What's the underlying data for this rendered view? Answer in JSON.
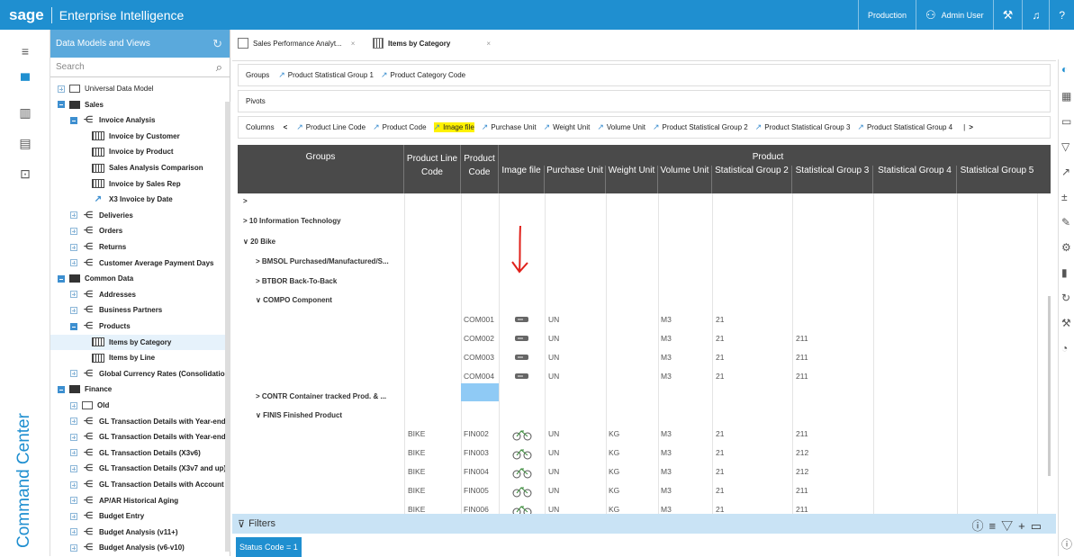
{
  "header": {
    "brand": "sage",
    "title": "Enterprise Intelligence",
    "env": "Production",
    "user": "Admin User"
  },
  "rail": {
    "vertical_label": "Command Center"
  },
  "panel": {
    "title": "Data Models and Views",
    "search_placeholder": "Search",
    "tree": [
      {
        "label": "Universal Data Model",
        "kind": "folder-empty",
        "indent": 0
      },
      {
        "label": "Sales",
        "kind": "folder",
        "indent": 0
      },
      {
        "label": "Invoice Analysis",
        "kind": "model",
        "indent": 1
      },
      {
        "label": "Invoice by Customer",
        "kind": "grid",
        "indent": 2
      },
      {
        "label": "Invoice by Product",
        "kind": "grid",
        "indent": 2
      },
      {
        "label": "Sales Analysis Comparison",
        "kind": "grid",
        "indent": 2
      },
      {
        "label": "Invoice by Sales Rep",
        "kind": "grid",
        "indent": 2
      },
      {
        "label": "X3 Invoice by Date",
        "kind": "chart",
        "indent": 2
      },
      {
        "label": "Deliveries",
        "kind": "model",
        "indent": 1
      },
      {
        "label": "Orders",
        "kind": "model",
        "indent": 1
      },
      {
        "label": "Returns",
        "kind": "model",
        "indent": 1
      },
      {
        "label": "Customer Average Payment Days",
        "kind": "model",
        "indent": 1
      },
      {
        "label": "Common Data",
        "kind": "folder",
        "indent": 0
      },
      {
        "label": "Addresses",
        "kind": "model",
        "indent": 1
      },
      {
        "label": "Business Partners",
        "kind": "model",
        "indent": 1
      },
      {
        "label": "Products",
        "kind": "model",
        "indent": 1
      },
      {
        "label": "Items by Category",
        "kind": "grid",
        "indent": 2
      },
      {
        "label": "Items by Line",
        "kind": "grid",
        "indent": 2
      },
      {
        "label": "Global Currency Rates (Consolidation)",
        "kind": "model",
        "indent": 1
      },
      {
        "label": "Finance",
        "kind": "folder",
        "indent": 0
      },
      {
        "label": "Old",
        "kind": "folder-empty",
        "indent": 1
      },
      {
        "label": "GL Transaction Details with Year-end S",
        "kind": "model",
        "indent": 1
      },
      {
        "label": "GL Transaction Details with Year-end S",
        "kind": "model",
        "indent": 1
      },
      {
        "label": "GL Transaction Details (X3v6)",
        "kind": "model",
        "indent": 1
      },
      {
        "label": "GL Transaction Details (X3v7 and up)",
        "kind": "model",
        "indent": 1
      },
      {
        "label": "GL Transaction Details with Account Py",
        "kind": "model",
        "indent": 1
      },
      {
        "label": "AP/AR Historical Aging",
        "kind": "model",
        "indent": 1
      },
      {
        "label": "Budget Entry",
        "kind": "model",
        "indent": 1
      },
      {
        "label": "Budget Analysis (v11+)",
        "kind": "model",
        "indent": 1
      },
      {
        "label": "Budget Analysis (v6-v10)",
        "kind": "model",
        "indent": 1
      }
    ]
  },
  "tabs": [
    {
      "label": "Sales Performance Analyt...",
      "close": "×"
    },
    {
      "label": "Items by Category",
      "close": "×"
    }
  ],
  "groups_bar": {
    "label": "Groups",
    "items": [
      "Product Statistical Group 1",
      "Product Category Code"
    ]
  },
  "pivots_bar": {
    "label": "Pivots"
  },
  "columns_bar": {
    "label": "Columns",
    "items": [
      "Product Line Code",
      "Product Code",
      "Image file",
      "Purchase Unit",
      "Weight Unit",
      "Volume Unit",
      "Product Statistical Group 2",
      "Product Statistical Group 3",
      "Product Statistical Group 4"
    ],
    "highlighted": "Image file"
  },
  "table": {
    "group_header": "Groups",
    "product_header": "Product",
    "columns": [
      {
        "l1": "Product Line",
        "l2": "Code"
      },
      {
        "l1": "Product",
        "l2": "Code"
      },
      {
        "l1": "",
        "l2": "Image file"
      },
      {
        "l1": "",
        "l2": "Purchase Unit"
      },
      {
        "l1": "",
        "l2": "Weight Unit"
      },
      {
        "l1": "",
        "l2": "Volume Unit"
      },
      {
        "l1": "",
        "l2": "Statistical Group 2"
      },
      {
        "l1": "",
        "l2": "Statistical Group 3"
      },
      {
        "l1": "",
        "l2": "Statistical Group 4"
      },
      {
        "l1": "",
        "l2": "Statistical Group 5"
      }
    ],
    "groups": [
      {
        "text": ">",
        "level": 0
      },
      {
        "text": "> 10 Information Technology",
        "level": 0
      },
      {
        "text": "∨ 20 Bike",
        "level": 0
      },
      {
        "text": "> BMSOL Purchased/Manufactured/S...",
        "level": 1
      },
      {
        "text": "> BTBOR Back-To-Back",
        "level": 1
      },
      {
        "text": "∨ COMPO Component",
        "level": 1
      },
      {
        "text": "> CONTR Container tracked Prod. & ...",
        "level": 1
      },
      {
        "text": "∨ FINIS Finished Product",
        "level": 1
      }
    ],
    "rows": [
      {
        "line": "",
        "code": "COM001",
        "img": "component",
        "pu": "UN",
        "wu": "",
        "vu": "M3",
        "sg2": "21",
        "sg3": ""
      },
      {
        "line": "",
        "code": "COM002",
        "img": "component",
        "pu": "UN",
        "wu": "",
        "vu": "M3",
        "sg2": "21",
        "sg3": "211"
      },
      {
        "line": "",
        "code": "COM003",
        "img": "component",
        "pu": "UN",
        "wu": "",
        "vu": "M3",
        "sg2": "21",
        "sg3": "211"
      },
      {
        "line": "",
        "code": "COM004",
        "img": "component",
        "pu": "UN",
        "wu": "",
        "vu": "M3",
        "sg2": "21",
        "sg3": "211"
      },
      {
        "line": "BIKE",
        "code": "FIN002",
        "img": "bike",
        "pu": "UN",
        "wu": "KG",
        "vu": "M3",
        "sg2": "21",
        "sg3": "211"
      },
      {
        "line": "BIKE",
        "code": "FIN003",
        "img": "bike",
        "pu": "UN",
        "wu": "KG",
        "vu": "M3",
        "sg2": "21",
        "sg3": "212"
      },
      {
        "line": "BIKE",
        "code": "FIN004",
        "img": "bike",
        "pu": "UN",
        "wu": "KG",
        "vu": "M3",
        "sg2": "21",
        "sg3": "212"
      },
      {
        "line": "BIKE",
        "code": "FIN005",
        "img": "bike",
        "pu": "UN",
        "wu": "KG",
        "vu": "M3",
        "sg2": "21",
        "sg3": "211"
      },
      {
        "line": "BIKE",
        "code": "FIN006",
        "img": "bike",
        "pu": "UN",
        "wu": "KG",
        "vu": "M3",
        "sg2": "21",
        "sg3": "211"
      }
    ]
  },
  "filters": {
    "label": "Filters",
    "status_chip": "Status Code = 1"
  },
  "colors": {
    "brand": "#1f8fd0",
    "panel_head": "#5aa9dc",
    "header_dark": "#4a4a4a",
    "highlight": "#fff200",
    "selection": "#8fcaf5",
    "annotation": "#e0201a"
  }
}
